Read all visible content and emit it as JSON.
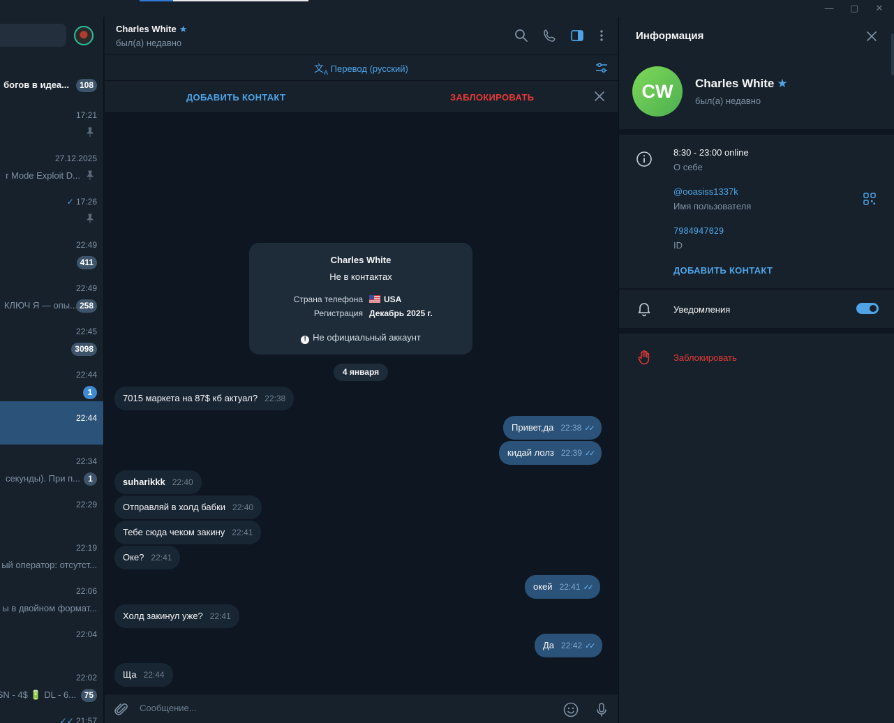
{
  "window": {
    "minimize": "—",
    "maximize": "▢",
    "close": "✕"
  },
  "sidebar": {
    "items": [
      {
        "name": "богов в идеа...",
        "time": "",
        "preview": "",
        "badge": "108",
        "badge_color": "muted"
      },
      {
        "name": "",
        "time": "17:21",
        "preview": "",
        "badge": "",
        "pinned": true
      },
      {
        "name": "",
        "time": "27.12.2025",
        "preview": "r Mode Exploit D...",
        "badge": "",
        "pinned": true
      },
      {
        "name": "",
        "time": "17:26",
        "preview": "",
        "badge": "",
        "pinned": true,
        "read": true
      },
      {
        "name": "",
        "time": "22:49",
        "preview": "",
        "badge": "411"
      },
      {
        "name": "",
        "time": "22:49",
        "preview": "КЛЮЧ Я — опы...",
        "badge": "258"
      },
      {
        "name": "",
        "time": "22:45",
        "preview": "",
        "badge": "3098"
      },
      {
        "name": "",
        "time": "22:44",
        "preview": "",
        "badge": "1",
        "badge_color": "blue"
      },
      {
        "name": "",
        "time": "22:44",
        "preview": "",
        "badge": "",
        "active": true
      },
      {
        "name": "",
        "time": "22:34",
        "preview": "секунды). При п...",
        "badge": "1"
      },
      {
        "name": "",
        "time": "22:29",
        "preview": "",
        "badge": ""
      },
      {
        "name": "",
        "time": "22:19",
        "preview": "ый оператор: отсутст...",
        "badge": ""
      },
      {
        "name": "",
        "time": "22:06",
        "preview": "ы в двойном формат...",
        "badge": ""
      },
      {
        "name": "",
        "time": "22:04",
        "preview": "",
        "badge": ""
      },
      {
        "name": "",
        "time": "22:02",
        "preview": "SN - 4$ 🔋 DL - 6...",
        "badge": "75"
      },
      {
        "name": "",
        "time": "21:57",
        "preview": "",
        "badge": "",
        "read": true
      }
    ]
  },
  "header": {
    "name": "Charles White",
    "status": "был(а) недавно",
    "icons": [
      "search-icon",
      "phone-icon",
      "sidebar-toggle-icon",
      "more-icon"
    ]
  },
  "translate": {
    "label": "Перевод (русский)"
  },
  "actions": {
    "add_contact": "ДОБАВИТЬ КОНТАКТ",
    "block": "ЗАБЛОКИРОВАТЬ"
  },
  "info_card": {
    "title": "Charles White",
    "subtitle": "Не в контактах",
    "phone_country_label": "Страна телефона",
    "phone_country_value": "USA",
    "registration_label": "Регистрация",
    "registration_value": "Декабрь 2025 г.",
    "note": "Не официальный аккаунт"
  },
  "date_chip": "4 января",
  "messages": [
    {
      "dir": "in",
      "text": "7015 маркета на 87$ кб актуал?",
      "time": "22:38"
    },
    {
      "dir": "out",
      "text": "Привет,да",
      "time": "22:38"
    },
    {
      "dir": "out",
      "text": "кидай лолз",
      "time": "22:39"
    },
    {
      "dir": "in",
      "text": "suharikkk",
      "time": "22:40",
      "bold": true
    },
    {
      "dir": "in",
      "text": "Отправляй в холд бабки",
      "time": "22:40"
    },
    {
      "dir": "in",
      "text": "Тебе сюда чеком закину",
      "time": "22:41"
    },
    {
      "dir": "in",
      "text": "Оке?",
      "time": "22:41"
    },
    {
      "dir": "out",
      "text": "окей",
      "time": "22:41"
    },
    {
      "dir": "in",
      "text": "Холд закинул уже?",
      "time": "22:41"
    },
    {
      "dir": "out",
      "text": "Да",
      "time": "22:42"
    },
    {
      "dir": "in",
      "text": "Ща",
      "time": "22:44"
    }
  ],
  "composer": {
    "placeholder": "Сообщение..."
  },
  "info_panel": {
    "title": "Информация",
    "avatar_initials": "CW",
    "name": "Charles White",
    "status": "был(а) недавно",
    "bio_value": "8:30 - 23:00 online",
    "bio_label": "О себе",
    "username_value": "@ooasiss1337k",
    "username_label": "Имя пользователя",
    "id_value": "7984947029",
    "id_label": "ID",
    "add_contact": "ДОБАВИТЬ КОНТАКТ",
    "notifications_label": "Уведомления",
    "notifications_on": true,
    "block_label": "Заблокировать"
  },
  "colors": {
    "accent": "#4fa4e8",
    "danger": "#e53935",
    "bg": "#0e1621",
    "panel": "#17212b",
    "bubble_in": "#182533",
    "bubble_out": "#2b5278",
    "avatar_green": "#4caf50"
  }
}
